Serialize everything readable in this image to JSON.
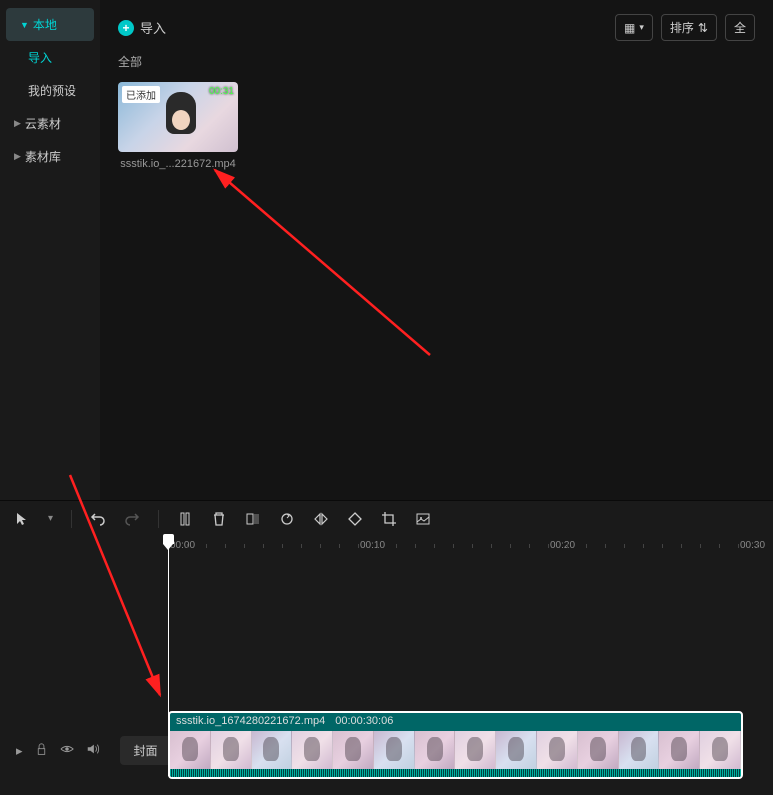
{
  "sidebar": {
    "items": [
      {
        "label": "本地",
        "active": true,
        "expanded": true
      },
      {
        "label": "导入",
        "sub": true,
        "active": true
      },
      {
        "label": "我的预设",
        "sub": true
      },
      {
        "label": "云素材"
      },
      {
        "label": "素材库"
      }
    ]
  },
  "header": {
    "import_label": "导入",
    "sort_label": "排序",
    "all_label": "全"
  },
  "category": {
    "label": "全部"
  },
  "media": {
    "added_badge": "已添加",
    "duration": "00:31",
    "filename": "ssstik.io_...221672.mp4"
  },
  "ruler": {
    "ticks": [
      "00:00",
      "00:10",
      "00:20",
      "00:30"
    ]
  },
  "timeline_left": {
    "cover_label": "封面"
  },
  "clip": {
    "filename": "ssstik.io_1674280221672.mp4",
    "duration": "00:00:30:06"
  }
}
